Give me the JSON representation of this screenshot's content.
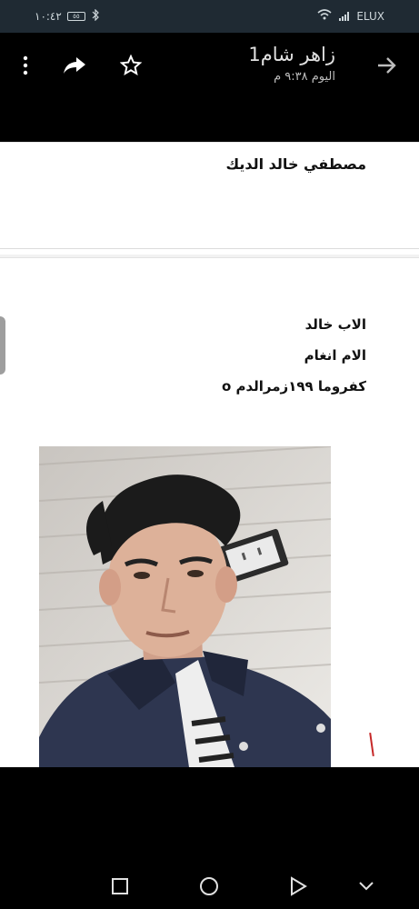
{
  "status_bar": {
    "time": "١٠:٤٢",
    "battery": "٥٥",
    "carrier": "ELUX"
  },
  "app_bar": {
    "title": "زاهر شام1",
    "subtitle": "اليوم ٩:٣٨ م",
    "icons": [
      "more-vert-icon",
      "share-icon",
      "star-icon",
      "arrow-forward-icon"
    ]
  },
  "message": {
    "sender_line": "مصطفي خالد الديك",
    "lines": [
      "الاب خالد",
      "الام انغام",
      "كفروما ١٩٩زمرالدم o"
    ]
  },
  "nav_bar": {
    "icons": [
      "square-icon",
      "circle-icon",
      "triangle-icon",
      "chevron-down-icon"
    ]
  },
  "colors": {
    "status_bg": "#1f2a33",
    "app_bg": "#000000",
    "doc_bg": "#ffffff",
    "mark": "#c62828"
  }
}
